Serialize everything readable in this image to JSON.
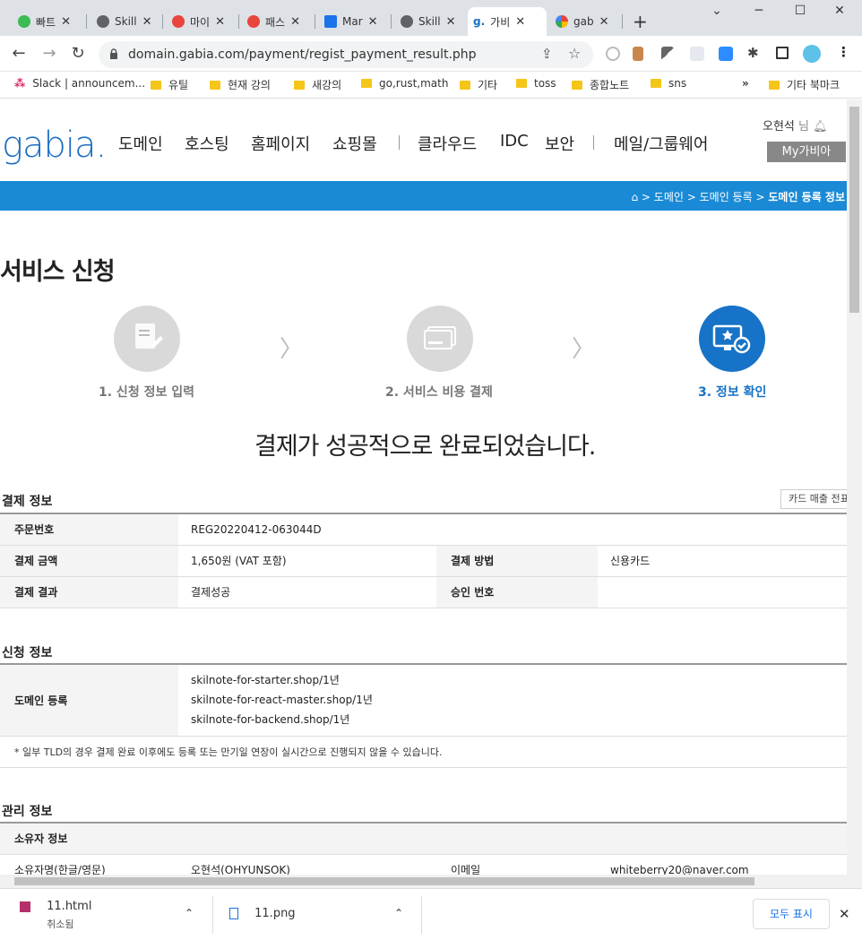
{
  "browser": {
    "tabs": [
      {
        "label": "빠트",
        "active": false
      },
      {
        "label": "Skill",
        "active": false
      },
      {
        "label": "마이",
        "active": false
      },
      {
        "label": "패스",
        "active": false
      },
      {
        "label": "Mar",
        "active": false
      },
      {
        "label": "Skill",
        "active": false
      },
      {
        "label": "가비",
        "active": true
      },
      {
        "label": "gab",
        "active": false
      }
    ],
    "new_tab": "+",
    "url": "domain.gabia.com/payment/regist_payment_result.php",
    "bookmarks": [
      "Slack | announcem...",
      "유틸",
      "현재 강의",
      "새강의",
      "go,rust,math",
      "기타",
      "toss",
      "종합노트",
      "sns"
    ],
    "bookmarks_overflow": "»",
    "other_bookmarks": "기타 북마크"
  },
  "header": {
    "logo": "gabia.",
    "gnb": [
      "도메인",
      "호스팅",
      "홈페이지",
      "쇼핑몰",
      "클라우드",
      "IDC",
      "보안",
      "메일/그룹웨어"
    ],
    "user_name": "오현석",
    "user_suffix": "님",
    "my_button": "My가비아"
  },
  "breadcrumb": {
    "items": [
      "도메인",
      "도메인 등록"
    ],
    "current": "도메인 등록 정보",
    "separator": ">"
  },
  "main": {
    "title": "서비스 신청",
    "steps": [
      {
        "label": "1. 신청 정보 입력",
        "active": false
      },
      {
        "label": "2. 서비스 비용 결제",
        "active": false
      },
      {
        "label": "3. 정보 확인",
        "active": true
      }
    ],
    "done_message": "결제가 성공적으로 완료되었습니다."
  },
  "payment": {
    "section_title": "결제 정보",
    "receipt_button": "카드 매출 전표",
    "order_no_label": "주문번호",
    "order_no": "REG20220412-063044D",
    "amount_label": "결제 금액",
    "amount": "1,650원 (VAT 포함)",
    "method_label": "결제 방법",
    "method": "신용카드",
    "result_label": "결제 결과",
    "result": "결제성공",
    "approval_label": "승인 번호",
    "approval": ""
  },
  "application": {
    "section_title": "신청 정보",
    "domain_label": "도메인 등록",
    "domains": [
      "skilnote-for-starter.shop/1년",
      "skilnote-for-react-master.shop/1년",
      "skilnote-for-backend.shop/1년"
    ],
    "note": "* 일부 TLD의 경우 결제 완료 이후에도 등록 또는 만기일 연장이 실시간으로 진행되지 않을 수 있습니다."
  },
  "management": {
    "section_title": "관리 정보",
    "owner_header": "소유자 정보",
    "owner_name_label": "소유자명(한글/영문)",
    "owner_name": "오현석(OHYUNSOK)",
    "email_label": "이메일",
    "email": "whiteberry20@naver.com"
  },
  "downloads": {
    "items": [
      {
        "name": "11.html",
        "status": "취소됨"
      },
      {
        "name": "11.png",
        "status": ""
      }
    ],
    "show_all": "모두 표시",
    "close": "✕"
  },
  "colors": {
    "brand": "#1b6ec2",
    "bar": "#1a8ad6",
    "step_active": "#1673c7"
  }
}
